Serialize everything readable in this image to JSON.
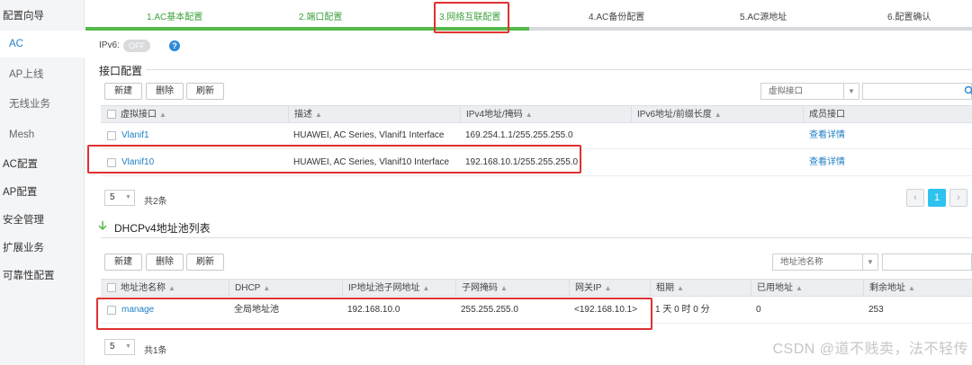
{
  "sidebar": {
    "items": [
      {
        "label": "配置向导"
      },
      {
        "label": "AC"
      },
      {
        "label": "AP上线"
      },
      {
        "label": "无线业务"
      },
      {
        "label": "Mesh"
      },
      {
        "label": "AC配置"
      },
      {
        "label": "AP配置"
      },
      {
        "label": "安全管理"
      },
      {
        "label": "扩展业务"
      },
      {
        "label": "可靠性配置"
      }
    ]
  },
  "wizard": {
    "steps": [
      {
        "label": "1.AC基本配置"
      },
      {
        "label": "2.端口配置"
      },
      {
        "label": "3.网络互联配置"
      },
      {
        "label": "4.AC备份配置"
      },
      {
        "label": "5.AC源地址"
      },
      {
        "label": "6.配置确认"
      }
    ],
    "progress_fraction": 0.5,
    "colors": {
      "done": "#3aa13a",
      "bar": "#55b84a",
      "highlight": "#e03030"
    }
  },
  "ipv6": {
    "label": "IPv6:",
    "toggle": "OFF",
    "help": "?"
  },
  "interface_section": {
    "title": "接口配置",
    "buttons": {
      "new": "新建",
      "delete": "删除",
      "refresh": "刷新"
    },
    "filter_select": "虚拟接口",
    "columns": [
      "虚拟接口",
      "描述",
      "IPv4地址/掩码",
      "IPv6地址/前缀长度",
      "成员接口"
    ],
    "rows": [
      {
        "name": "Vlanif1",
        "desc": "HUAWEI, AC Series, Vlanif1 Interface",
        "ipv4": "169.254.1.1/255.255.255.0",
        "ipv6": "",
        "member": "查看详情"
      },
      {
        "name": "Vlanif10",
        "desc": "HUAWEI, AC Series, Vlanif10 Interface",
        "ipv4": "192.168.10.1/255.255.255.0",
        "ipv6": "",
        "member": "查看详情"
      }
    ],
    "page_size": "5",
    "total": "共2条",
    "pager": {
      "prev": "‹",
      "current": "1",
      "next": "›"
    }
  },
  "dhcp_section": {
    "title": "DHCPv4地址池列表",
    "buttons": {
      "new": "新建",
      "delete": "删除",
      "refresh": "刷新"
    },
    "filter_select": "地址池名称",
    "columns": [
      "地址池名称",
      "DHCP",
      "IP地址池子网地址",
      "子网掩码",
      "网关IP",
      "租期",
      "已用地址",
      "剩余地址"
    ],
    "rows": [
      {
        "name": "manage",
        "dhcp": "全局地址池",
        "subnet": "192.168.10.0",
        "mask": "255.255.255.0",
        "gateway": "<192.168.10.1>",
        "lease": "1 天 0 时 0 分",
        "used": "0",
        "remaining": "253"
      }
    ],
    "page_size": "5",
    "total": "共1条"
  },
  "watermark": "CSDN @道不贱卖，法不轻传"
}
